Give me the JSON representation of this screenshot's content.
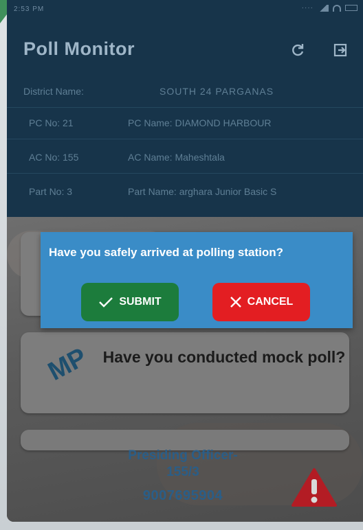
{
  "status_bar": {
    "time": "2:53 PM"
  },
  "app": {
    "title": "Poll Monitor",
    "refresh_icon": "refresh-icon",
    "logout_icon": "logout-icon"
  },
  "details": {
    "district_label": "District Name:",
    "district_value": "SOUTH 24 PARGANAS",
    "pc_no": "PC No: 21",
    "pc_name": "PC Name: DIAMOND HARBOUR",
    "ac_no": "AC No: 155",
    "ac_name": "AC Name: Maheshtala",
    "part_no": "Part No: 3",
    "part_name": "Part Name: arghara Junior Basic S"
  },
  "cards": {
    "mock_poll_logo": "MP",
    "mock_poll_question": "Have you conducted mock poll?"
  },
  "officer": {
    "title": "Presiding Officer-",
    "code": "155/3",
    "phone": "9007695904"
  },
  "dialog": {
    "message": "Have you safely arrived at polling station?",
    "submit_label": "SUBMIT",
    "cancel_label": "CANCEL"
  },
  "colors": {
    "header_bg": "#17344a",
    "dialog_bg": "#3a8cc7",
    "submit": "#1c7c3c",
    "cancel": "#e31e22",
    "alert": "#b31c24"
  }
}
